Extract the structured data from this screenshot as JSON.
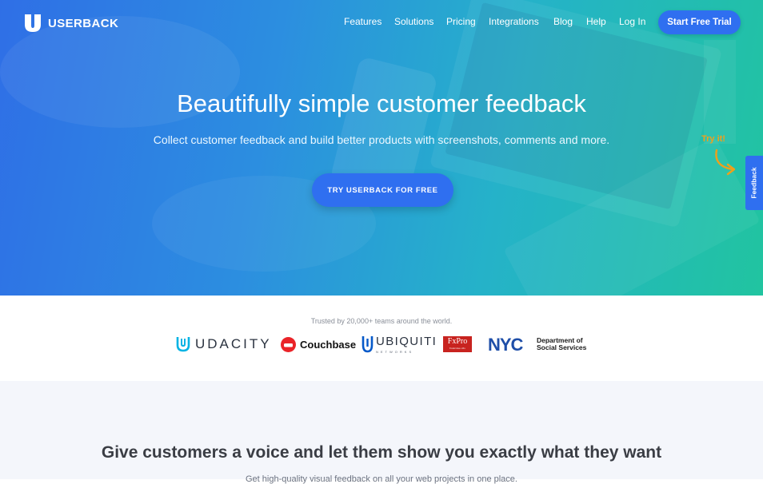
{
  "brand": {
    "name": "USERBACK",
    "accent": "#2f6ff0",
    "gradient": [
      "#2f6fe6",
      "#21c4a0"
    ]
  },
  "nav": {
    "items": [
      "Features",
      "Solutions",
      "Pricing",
      "Integrations",
      "Blog",
      "Help",
      "Log In"
    ],
    "cta": "Start Free Trial"
  },
  "hero": {
    "title": "Beautifully simple customer feedback",
    "subtitle": "Collect customer feedback and build better products with screenshots, comments and more.",
    "cta": "TRY USERBACK FOR FREE",
    "try_it": "Try it!",
    "feedback_tab": "Feedback"
  },
  "trust": {
    "text": "Trusted by 20,000+ teams around the world.",
    "logos": {
      "udacity": "UDACITY",
      "couchbase": "Couchbase",
      "ubiquiti": "UBIQUITI",
      "ubiquiti_sub": "NETWORKS",
      "fxpro": "FxPro",
      "fxpro_sub": "Trade Like a Pro",
      "nyc": "NYC",
      "nyc_line1": "Department of",
      "nyc_line2": "Social Services"
    }
  },
  "section": {
    "title": "Give customers a voice and let them show you exactly what they want",
    "subtitle": "Get high-quality visual feedback on all your web projects in one place."
  }
}
